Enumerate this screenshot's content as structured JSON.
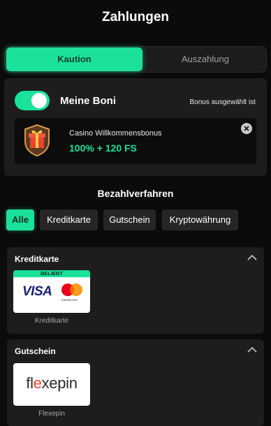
{
  "header": {
    "title": "Zahlungen"
  },
  "tabs": [
    {
      "label": "Kaution",
      "active": true
    },
    {
      "label": "Auszahlung",
      "active": false
    }
  ],
  "bonus": {
    "toggle_on": true,
    "label": "Meine Boni",
    "status": "Bonus ausgewählt ist",
    "name": "Casino Willkommensbonus",
    "value": "100% + 120 FS",
    "icon": "gift-icon"
  },
  "payment": {
    "section_title": "Bezahlverfahren",
    "filters": [
      {
        "label": "Alle",
        "active": true
      },
      {
        "label": "Kreditkarte",
        "active": false
      },
      {
        "label": "Gutschein",
        "active": false
      },
      {
        "label": "Kryptowährung",
        "active": false
      }
    ],
    "groups": [
      {
        "title": "Kreditkarte",
        "items": [
          {
            "label": "Kreditkarte",
            "badge": "BELIEBT",
            "logo_text": "VISA",
            "logo_sub": "mastercard"
          }
        ]
      },
      {
        "title": "Gutschein",
        "items": [
          {
            "label": "Flexepin",
            "logo_pre": "fl",
            "logo_x": "e",
            "logo_post": "xepin"
          }
        ]
      }
    ]
  },
  "colors": {
    "accent": "#1be29a",
    "background": "#0b0b0b",
    "card": "#1d1d1d"
  }
}
